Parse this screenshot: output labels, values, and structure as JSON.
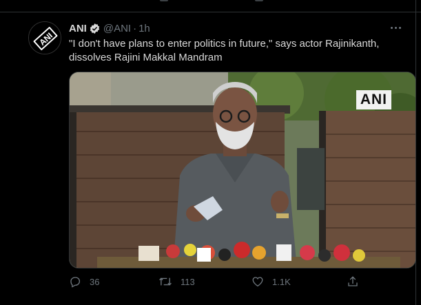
{
  "tweet": {
    "display_name": "ANI",
    "handle": "@ANI",
    "separator": "·",
    "time": "1h",
    "text": "\"I don't have plans to enter politics in future,\" says actor Rajinikanth, dissolves Rajini Makkal Mandram",
    "avatar_text": "ANI",
    "media_watermark": "ANI"
  },
  "actions": {
    "reply_count": "36",
    "retweet_count": "113",
    "like_count": "1.1K"
  },
  "icons": {
    "verified": "verified-badge-icon",
    "more": "more-options-icon",
    "reply": "reply-icon",
    "retweet": "retweet-icon",
    "like": "heart-icon",
    "share": "share-icon"
  },
  "colors": {
    "background": "#000000",
    "text": "#d9d9d9",
    "muted": "#6e767d",
    "border": "#2f3336"
  }
}
